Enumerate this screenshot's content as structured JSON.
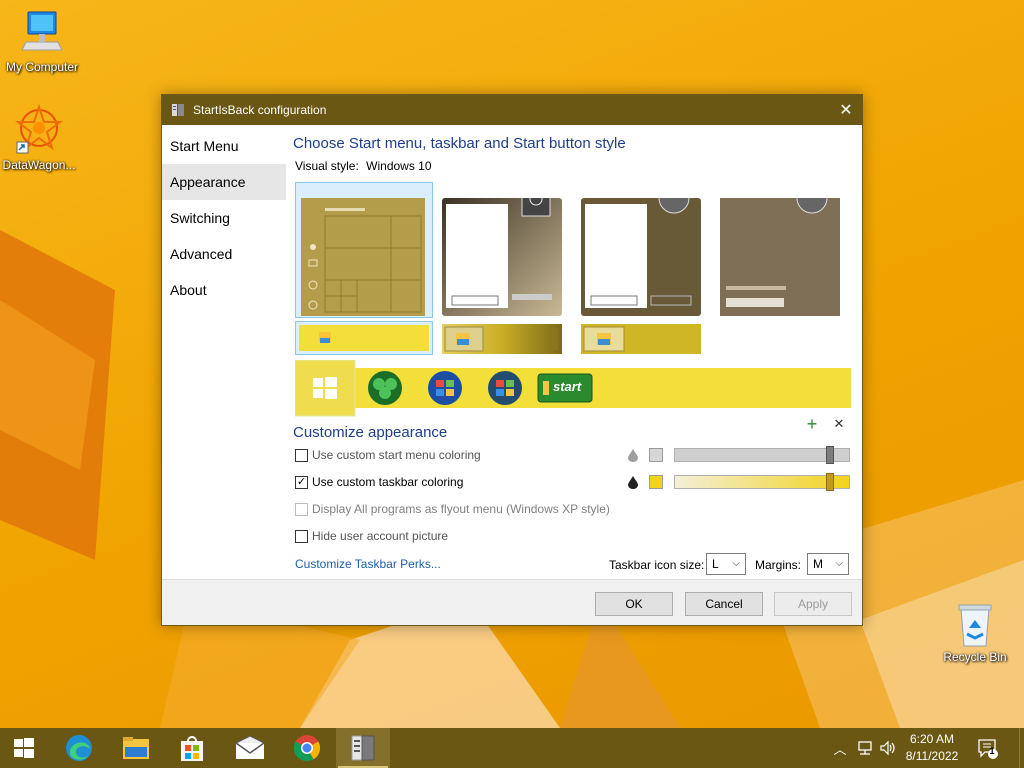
{
  "desktop": {
    "icons": [
      {
        "id": "my-computer",
        "label": "My Computer"
      },
      {
        "id": "datawagon",
        "label": "DataWagon..."
      },
      {
        "id": "recycle-bin",
        "label": "Recycle Bin"
      }
    ]
  },
  "window": {
    "title": "StartIsBack configuration",
    "close_glyph": "✕",
    "nav": [
      {
        "label": "Start Menu",
        "active": false
      },
      {
        "label": "Appearance",
        "active": true
      },
      {
        "label": "Switching",
        "active": false
      },
      {
        "label": "Advanced",
        "active": false
      },
      {
        "label": "About",
        "active": false
      }
    ],
    "main": {
      "heading": "Choose Start menu, taskbar and Start button style",
      "visual_style_label": "Visual style:",
      "visual_style_value": "Windows 10",
      "start_button_text": "start",
      "customize_heading": "Customize appearance",
      "add_glyph": "+",
      "remove_glyph": "✕",
      "options": [
        {
          "label": "Use custom start menu coloring",
          "checked": false,
          "enabled": true
        },
        {
          "label": "Use custom taskbar coloring",
          "checked": true,
          "enabled": true
        },
        {
          "label": "Display All programs as flyout menu (Windows XP style)",
          "checked": false,
          "enabled": false
        },
        {
          "label": "Hide user account picture",
          "checked": false,
          "enabled": true
        }
      ],
      "checkmark": "✓",
      "start_menu_color": "#d6d6d6",
      "taskbar_color": "#f2d31c",
      "start_menu_slider_value": 0.9,
      "taskbar_slider_value": 0.9,
      "link_text": "Customize Taskbar Perks...",
      "icon_size_label": "Taskbar icon size:",
      "icon_size_value": "L",
      "margins_label": "Margins:",
      "margins_value": "M"
    },
    "buttons": {
      "ok": "OK",
      "cancel": "Cancel",
      "apply": "Apply"
    }
  },
  "taskbar": {
    "apps": [
      "start",
      "edge",
      "file-explorer",
      "microsoft-store",
      "mail",
      "chrome",
      "startisback"
    ],
    "active_app": "startisback",
    "time": "6:20 AM",
    "date": "8/11/2022",
    "notification_count": "1"
  },
  "colors": {
    "accent_dark": "#6a5714",
    "heading_blue": "#1f3f8c",
    "link_blue": "#1f5ea8",
    "desktop_orange": "#f2a804"
  }
}
